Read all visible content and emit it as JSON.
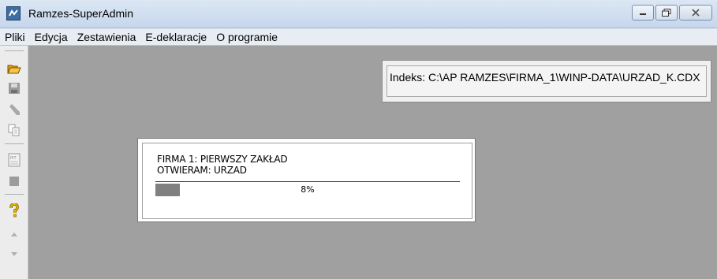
{
  "window": {
    "title": "Ramzes-SuperAdmin",
    "app_icon": "ramzes-app-icon",
    "controls": {
      "minimize_icon": "minimize-icon",
      "maximize_icon": "restore-icon",
      "close_icon": "close-icon"
    }
  },
  "menu": [
    "Pliki",
    "Edycja",
    "Zestawienia",
    "E-deklaracje",
    "O programie"
  ],
  "toolbar": {
    "icons": [
      "open-folder-icon",
      "save-icon",
      "pencil-icon",
      "copy-icon",
      "pit-form-icon",
      "stop-icon",
      "help-icon",
      "scroll-up-icon",
      "scroll-down-icon"
    ]
  },
  "indeks_panel": {
    "text": "Indeks: C:\\AP RAMZES\\FIRMA_1\\WINP-DATA\\URZAD_K.CDX"
  },
  "progress_dialog": {
    "line1": "FIRMA 1: PIERWSZY ZAKŁAD",
    "line2": "OTWIERAM: URZAD",
    "progress_percent": 8,
    "progress_label": "8%"
  },
  "colors": {
    "workspace": "#a0a0a0",
    "progress_fill": "#808080",
    "help_icon": "#e0b800"
  }
}
